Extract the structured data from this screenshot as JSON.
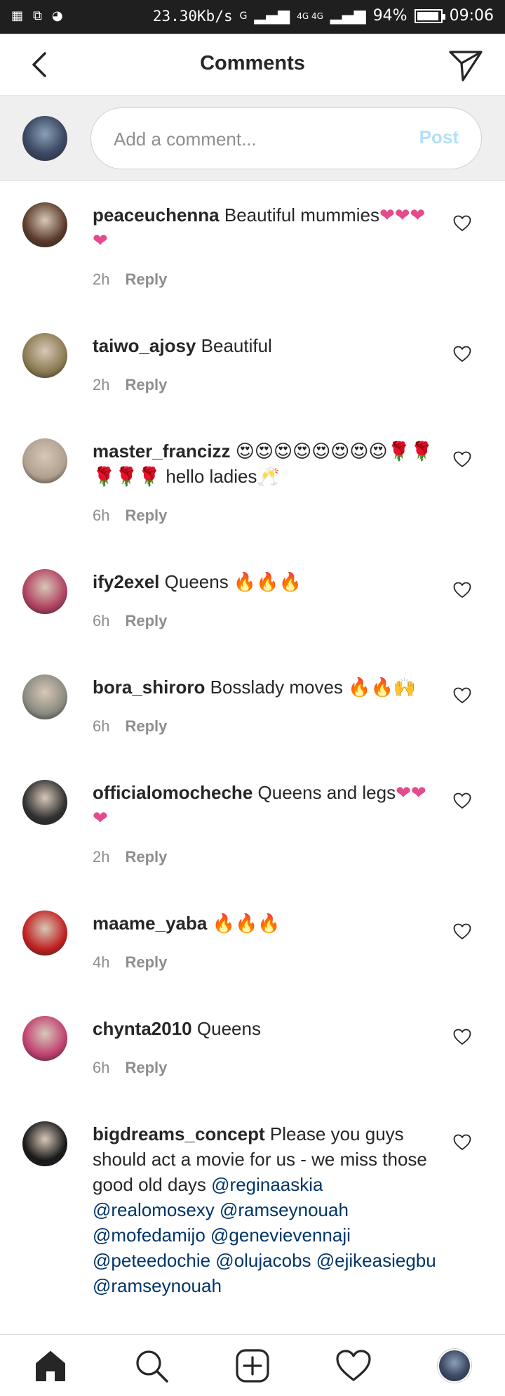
{
  "status_bar": {
    "speed": "23.30Kb/s",
    "signal1": "G",
    "signal2": "4G 4G",
    "battery": "94%",
    "battery_level": 0.94,
    "time": "09:06"
  },
  "header": {
    "title": "Comments"
  },
  "composer": {
    "placeholder": "Add a comment...",
    "post_label": "Post"
  },
  "comments": [
    {
      "username": "peaceuchenna",
      "text": "Beautiful mummies❤❤❤❤",
      "time": "2h",
      "reply": "Reply",
      "avatar_color": "#5a3a2a"
    },
    {
      "username": "taiwo_ajosy",
      "text": "Beautiful",
      "time": "2h",
      "reply": "Reply",
      "avatar_color": "#8a7a50"
    },
    {
      "username": "master_francizz",
      "text": "😍😍😍😍😍😍😍😍🌹🌹🌹🌹🌹 hello ladies🥂",
      "time": "6h",
      "reply": "Reply",
      "avatar_color": "#b0a090"
    },
    {
      "username": "ify2exel",
      "text": "Queens 🔥🔥🔥",
      "time": "6h",
      "reply": "Reply",
      "avatar_color": "#b04060"
    },
    {
      "username": "bora_shiroro",
      "text": "Bosslady moves 🔥🔥🙌",
      "time": "6h",
      "reply": "Reply",
      "avatar_color": "#8a8a80"
    },
    {
      "username": "officialomocheche",
      "text": "Queens and legs❤❤❤",
      "time": "2h",
      "reply": "Reply",
      "avatar_color": "#303030"
    },
    {
      "username": "maame_yaba",
      "text": "🔥🔥🔥",
      "time": "4h",
      "reply": "Reply",
      "avatar_color": "#c02020"
    },
    {
      "username": "chynta2010",
      "text": "Queens",
      "time": "6h",
      "reply": "Reply",
      "avatar_color": "#c04070"
    },
    {
      "username": "bigdreams_concept",
      "text": "Please you guys should act a movie for us - we miss those good old days",
      "mentions": [
        "@reginaaskia",
        "@realomosexy",
        "@ramseynouah",
        "@mofedamijo",
        "@genevievennaji",
        "@peteedochie",
        "@olujacobs",
        "@ejikeasiegbu",
        "@ramseynouah"
      ],
      "avatar_color": "#1a1a1a"
    }
  ],
  "colors": {
    "accent_blue": "#b2dffc",
    "mention": "#003569",
    "muted": "#8e8e8e"
  }
}
